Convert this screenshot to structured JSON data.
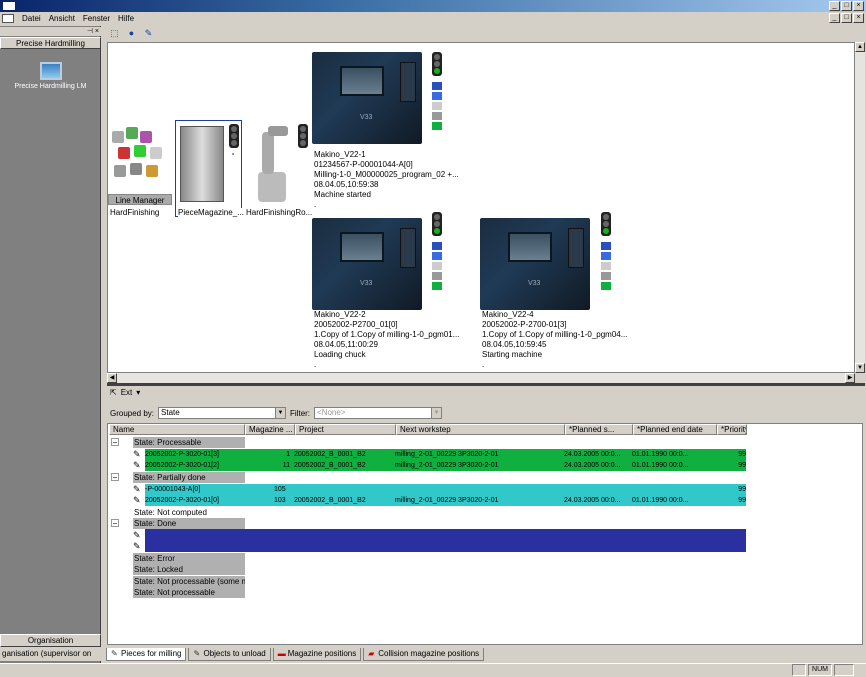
{
  "menu": [
    "Datei",
    "Ansicht",
    "Fenster",
    "Hilfe"
  ],
  "window_controls": [
    "_",
    "□",
    "×"
  ],
  "left": {
    "header": "Precise Hardmilling",
    "icon_label": "Precise Hardmilling LM",
    "bottom1": "Organisation",
    "bottom2": "ganisation (supervisor on"
  },
  "toolbar_icons": [
    "select-icon",
    "user-icon",
    "wrench-icon"
  ],
  "linemanager": {
    "label": "Line Manager",
    "sub": "HardFinishing"
  },
  "piecemagazine": {
    "label": "PieceMagazine_..."
  },
  "robot": {
    "label": "HardFinishingRo..."
  },
  "machines": [
    {
      "name": "Makino_V22-1",
      "l1": "01234567-P-00001044-A[0]",
      "l2": "Milling-1-0_M00000025_program_02 +...",
      "l3": "08.04.05,10:59:38",
      "l4": "Machine started",
      "l5": "."
    },
    {
      "name": "Makino_V22-2",
      "l1": "20052002-P2700_01[0]",
      "l2": "1.Copy of 1.Copy of milling-1-0_pgm01...",
      "l3": "08.04.05,11:00:29",
      "l4": "Loading chuck",
      "l5": "."
    },
    {
      "name": "Makino_V22-4",
      "l1": "20052002-P-2700-01[3]",
      "l2": "1.Copy of 1.Copy of milling-1-0_pgm04...",
      "l3": "08.04.05,10:59:45",
      "l4": "Starting machine",
      "l5": "."
    }
  ],
  "ext_label": "Ext",
  "grouped_by_label": "Grouped by:",
  "grouped_by_value": "State",
  "filter_label": "Filter:",
  "filter_value": "<None>",
  "columns": [
    "Name",
    "Magazine ...",
    "Project",
    "Next workstep",
    "*Planned s...",
    "*Planned end date",
    "*Priority"
  ],
  "states": [
    "State: Processable",
    "State: Partially done",
    "State: Not computed",
    "State: Done",
    "State: Error",
    "State: Locked",
    "State: Not processable (some m...",
    "State: Not processable"
  ],
  "rows_processable": [
    {
      "name": "20052002-P-3020-01[3]",
      "mag": "1",
      "proj": "20052002_B_0001_B2",
      "next": "milling_2-01_00229 3P3020-2-01",
      "start": "24.03.2005 00:0...",
      "end": "01.01.1990 00:0...",
      "prio": "99"
    },
    {
      "name": "20052002-P-3020-01[2]",
      "mag": "11",
      "proj": "20052002_B_0001_B2",
      "next": "milling_2-01_00229 3P3020-2-01",
      "start": "24.03.2005 00:0...",
      "end": "01.01.1990 00:0...",
      "prio": "99"
    }
  ],
  "rows_partial": [
    {
      "name": "-P-00001043-A[0]",
      "mag": "105",
      "proj": "",
      "next": "",
      "start": "",
      "end": "",
      "prio": "99"
    },
    {
      "name": "20052002-P-3020-01[0]",
      "mag": "103",
      "proj": "20052002_B_0001_B2",
      "next": "milling_2-01_00229 3P3020-2-01",
      "start": "24.03.2005 00:0...",
      "end": "01.01.1990 00:0...",
      "prio": "99"
    }
  ],
  "tabs": [
    "Pieces for milling",
    "Objects to unload",
    "Magazine positions",
    "Collision magazine positions"
  ],
  "status": {
    "num": "NUM"
  },
  "colors": {
    "green": "#10b040",
    "teal": "#30c8c8",
    "blue": "#2a30a0"
  }
}
